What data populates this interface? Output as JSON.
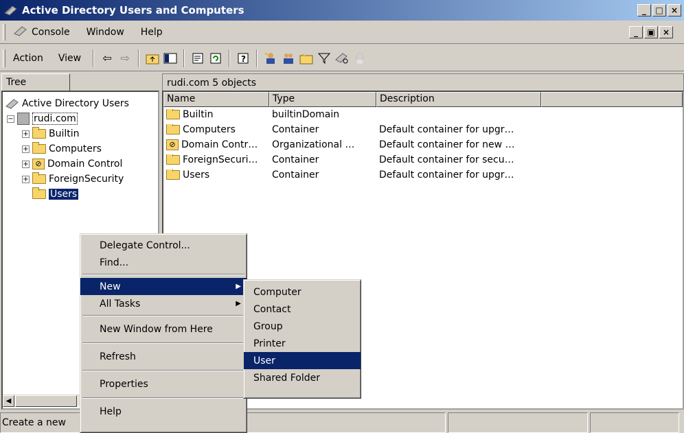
{
  "window": {
    "title": "Active Directory Users and Computers",
    "min": "_",
    "max": "□",
    "close": "×"
  },
  "menubar": {
    "items": [
      "Console",
      "Window",
      "Help"
    ],
    "child_min": "_",
    "child_restore": "▣",
    "child_close": "×"
  },
  "toolbar": {
    "action": "Action",
    "view": "View",
    "back": "⇦",
    "forward": "⇨"
  },
  "tree": {
    "tab": "Tree",
    "root": "Active Directory Users",
    "domain": "rudi.com",
    "children": [
      "Builtin",
      "Computers",
      "Domain Control",
      "ForeignSecurity",
      "Users"
    ]
  },
  "list": {
    "header": "rudi.com   5 objects",
    "columns": [
      "Name",
      "Type",
      "Description",
      ""
    ],
    "rows": [
      {
        "name": "Builtin",
        "type": "builtinDomain",
        "desc": ""
      },
      {
        "name": "Computers",
        "type": "Container",
        "desc": "Default container for upgr…"
      },
      {
        "name": "Domain Contr…",
        "type": "Organizational …",
        "desc": "Default container for new …"
      },
      {
        "name": "ForeignSecuri…",
        "type": "Container",
        "desc": "Default container for secu…"
      },
      {
        "name": "Users",
        "type": "Container",
        "desc": "Default container for upgr…"
      }
    ]
  },
  "context_menu": {
    "items": [
      "Delegate Control...",
      "Find...",
      "New",
      "All Tasks",
      "New Window from Here",
      "Refresh",
      "Properties",
      "Help"
    ]
  },
  "submenu": {
    "items": [
      "Computer",
      "Contact",
      "Group",
      "Printer",
      "User",
      "Shared Folder"
    ]
  },
  "status": {
    "text": "Create a new"
  }
}
